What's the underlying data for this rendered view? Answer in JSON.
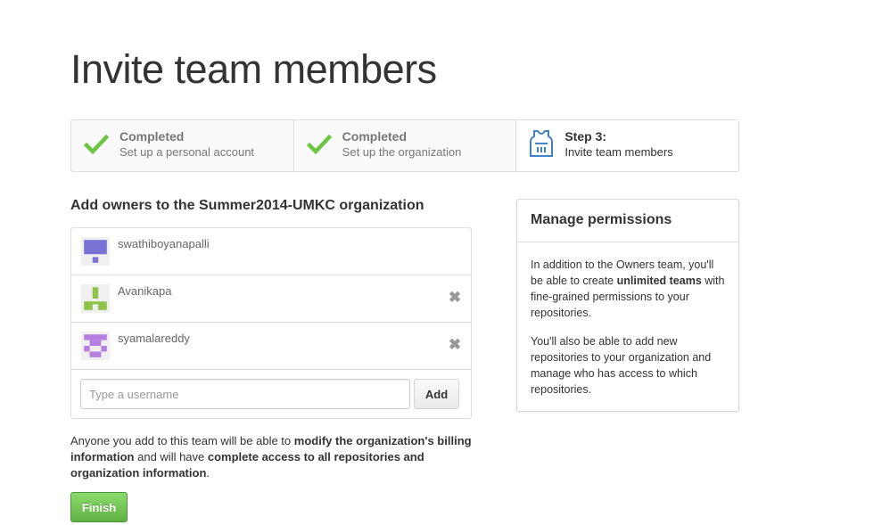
{
  "page": {
    "title": "Invite team members"
  },
  "steps": [
    {
      "title": "Completed",
      "desc": "Set up a personal account",
      "icon": "check-icon"
    },
    {
      "title": "Completed",
      "desc": "Set up the organization",
      "icon": "check-icon"
    },
    {
      "title": "Step 3:",
      "desc": "Invite team members",
      "icon": "jersey-icon"
    }
  ],
  "owners": {
    "heading": "Add owners to the Summer2014-UMKC organization",
    "members": [
      {
        "username": "swathiboyanapalli",
        "removable": false,
        "avatar_color": "#7b72d6"
      },
      {
        "username": "Avanikapa",
        "removable": true,
        "avatar_color": "#8cc44a"
      },
      {
        "username": "syamalareddy",
        "removable": true,
        "avatar_color": "#b57ee0"
      }
    ],
    "input_placeholder": "Type a username",
    "add_label": "Add",
    "remove_glyph": "✖"
  },
  "notice": {
    "part1": "Anyone you add to this team will be able to ",
    "bold1": "modify the organization's billing information",
    "part2": " and will have ",
    "bold2": "complete access to all repositories and organization information",
    "part3": "."
  },
  "finish_label": "Finish",
  "permissions": {
    "heading": "Manage permissions",
    "p1_a": "In addition to the Owners team, you'll be able to create ",
    "p1_bold": "unlimited teams",
    "p1_b": " with fine-grained permissions to your repositories.",
    "p2": "You'll also be able to add new repositories to your organization and manage who has access to which repositories."
  },
  "colors": {
    "check": "#6cc644",
    "finish": "#60b044",
    "jersey": "#4183c4"
  }
}
